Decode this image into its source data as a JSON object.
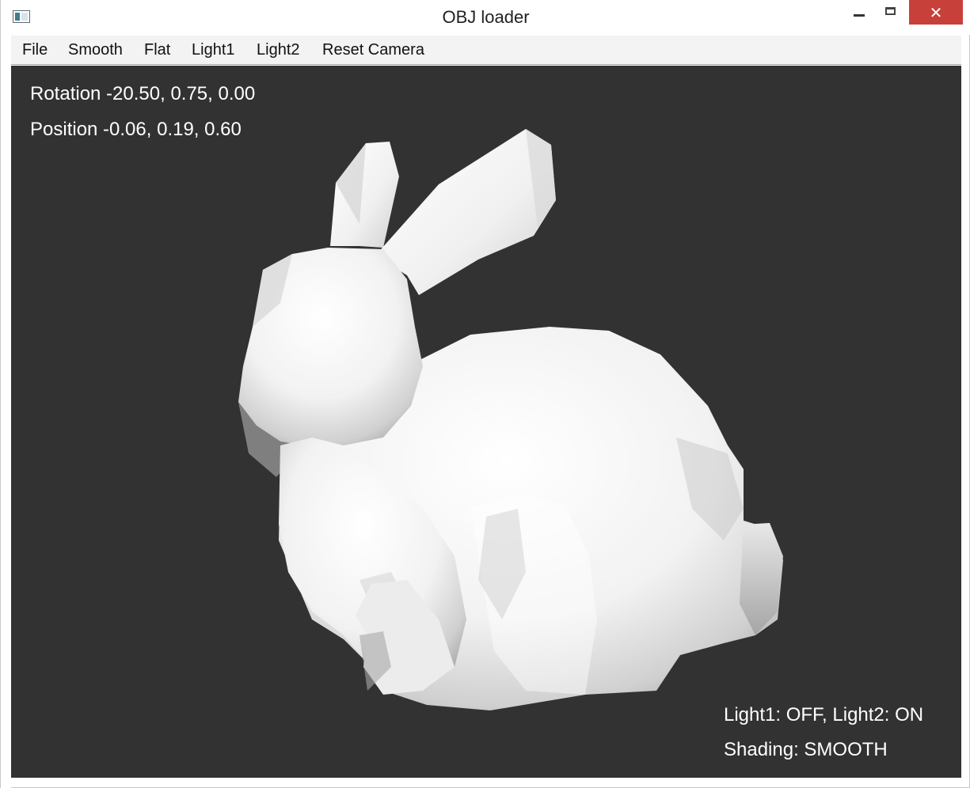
{
  "window": {
    "title": "OBJ loader",
    "icon": "app-window-icon",
    "controls": {
      "minimize_icon": "minimize-icon",
      "maximize_icon": "maximize-icon",
      "close_glyph": "✕"
    },
    "close_color": "#c7413a"
  },
  "menu": {
    "items": [
      "File",
      "Smooth",
      "Flat",
      "Light1",
      "Light2",
      "Reset Camera"
    ]
  },
  "viewport": {
    "background": "#323232",
    "hud": {
      "rotation": "Rotation -20.50, 0.75, 0.00",
      "position": "Position -0.06, 0.19, 0.60",
      "lights": "Light1: OFF, Light2: ON",
      "shading": "Shading: SMOOTH"
    },
    "model": "bunny-mesh"
  }
}
